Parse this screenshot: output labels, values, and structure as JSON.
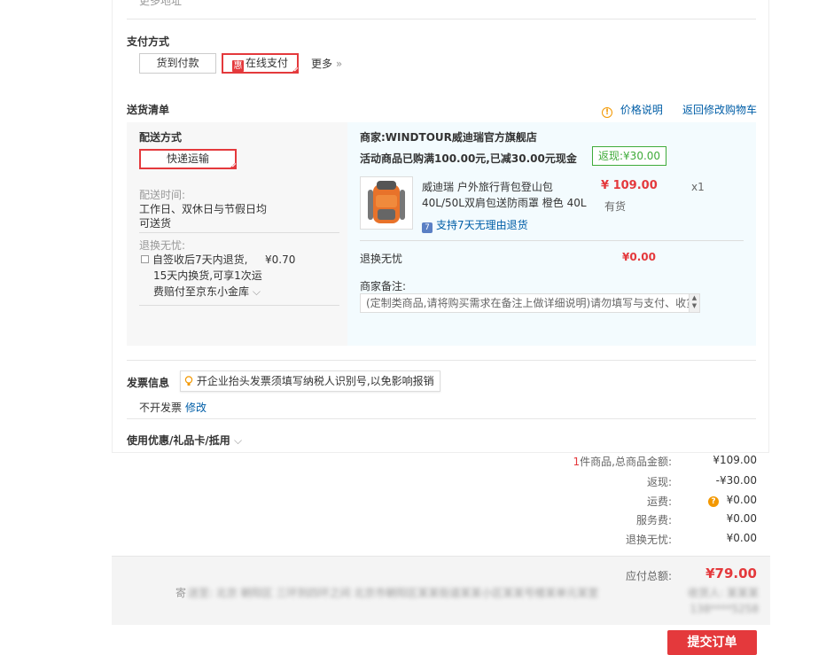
{
  "top_cut_text": "更多地址",
  "payment": {
    "title": "支付方式",
    "options": [
      {
        "label": "货到付款",
        "selected": false
      },
      {
        "label": "在线支付",
        "selected": true,
        "badge": "惠"
      }
    ],
    "more_label": "更多",
    "more_arrow": "»"
  },
  "delivery_list": {
    "title": "送货清单",
    "price_note_link": "价格说明",
    "back_to_cart_link": "返回修改购物车"
  },
  "shipping": {
    "title": "配送方式",
    "method": "快递运输",
    "time_label": "配送时间:",
    "time_value_line1": "工作日、双休日与节假日均",
    "time_value_line2": "可送货",
    "return_label": "退换无忧:",
    "return_option_line1": "自签收后7天内退货,",
    "return_option_line2": "15天内换货,可享1次运",
    "return_option_line3": "费赔付至京东小金库",
    "return_option_price": "¥0.70"
  },
  "merchant": {
    "name_line": "商家:WINDTOUR威迪瑞官方旗舰店",
    "promo": "活动商品已购满100.00元,已减30.00元现金",
    "rebate": "返现:¥30.00",
    "product": {
      "title_line1": "威迪瑞 户外旅行背包登山包",
      "title_line2": "40L/50L双肩包送防雨罩 橙色 40L",
      "price": "¥ 109.00",
      "qty": "x1",
      "stock": "有货",
      "return_policy": "支持7天无理由退货"
    },
    "return_worry_label": "退换无忧",
    "return_worry_price": "¥0.00",
    "remark_label": "商家备注:",
    "remark_placeholder": "(定制类商品,请将购买需求在备注上做详细说明)请勿填写与支付、收货相关信息"
  },
  "invoice": {
    "title": "发票信息",
    "tip": "开企业抬头发票须填写纳税人识别号,以免影响报销",
    "value": "不开发票",
    "modify_link": "修改"
  },
  "coupon": {
    "title": "使用优惠/礼品卡/抵用"
  },
  "summary": {
    "count": "1",
    "count_label": "件商品,总商品金额:",
    "total_goods": "¥109.00",
    "rebate_label": "返现:",
    "rebate_value": "-¥30.00",
    "freight_label": "运费:",
    "freight_value": "¥0.00",
    "service_label": "服务费:",
    "service_value": "¥0.00",
    "return_label": "退换无忧:",
    "return_value": "¥0.00"
  },
  "footer": {
    "payable_label": "应付总额:",
    "payable_value": "¥79.00",
    "address_prefix": "寄",
    "address_blurred": "送至: 北京 朝阳区 三环到四环之间 北京市朝阳区某某街道某某小区某某号楼某单元某室",
    "receiver_blurred": "收货人: 某某某",
    "phone_blurred": "138****5258"
  },
  "submit_label": "提交订单"
}
